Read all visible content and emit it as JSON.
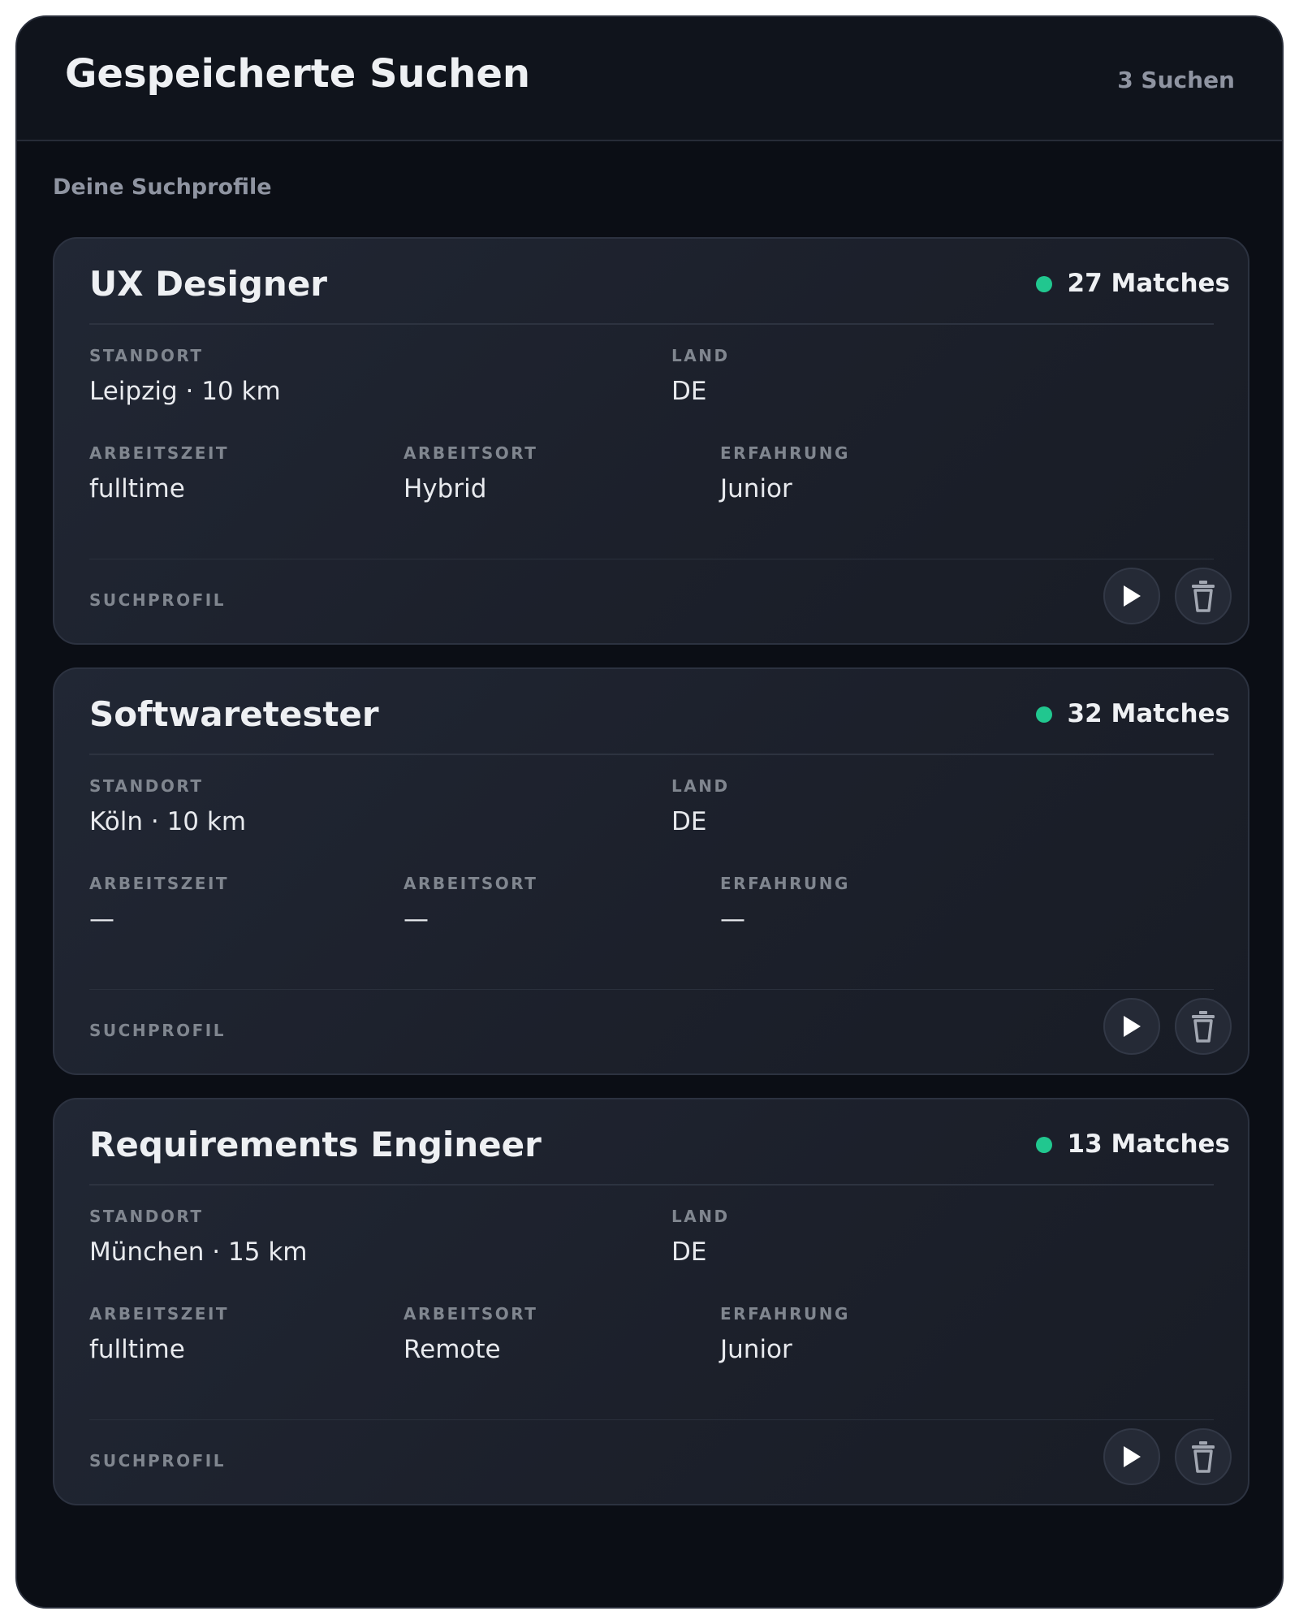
{
  "header": {
    "title": "Gespeicherte Suchen",
    "count": "3 Suchen"
  },
  "section_label": "Deine Suchprofile",
  "field_labels": {
    "standort": "STANDORT",
    "land": "LAND",
    "arbeitszeit": "ARBEITSZEIT",
    "arbeitsort": "ARBEITSORT",
    "erfahrung": "ERFAHRUNG",
    "footer": "SUCHPROFIL"
  },
  "searches": [
    {
      "title": "UX Designer",
      "matches": "27 Matches",
      "standort": "Leipzig · 10 km",
      "land": "DE",
      "arbeitszeit": "fulltime",
      "arbeitsort": "Hybrid",
      "erfahrung": "Junior"
    },
    {
      "title": "Softwaretester",
      "matches": "32 Matches",
      "standort": "Köln · 10 km",
      "land": "DE",
      "arbeitszeit": "—",
      "arbeitsort": "—",
      "erfahrung": "—"
    },
    {
      "title": "Requirements Engineer",
      "matches": "13 Matches",
      "standort": "München · 15 km",
      "land": "DE",
      "arbeitszeit": "fulltime",
      "arbeitsort": "Remote",
      "erfahrung": "Junior"
    }
  ],
  "icons": {
    "play": "play-icon",
    "delete": "trash-icon",
    "status": "status-dot"
  },
  "colors": {
    "background": "#0b0e15",
    "card": "#1f2430",
    "accent_green": "#21c78f",
    "text_primary": "#eef0f3",
    "text_muted": "#8f94a1"
  }
}
